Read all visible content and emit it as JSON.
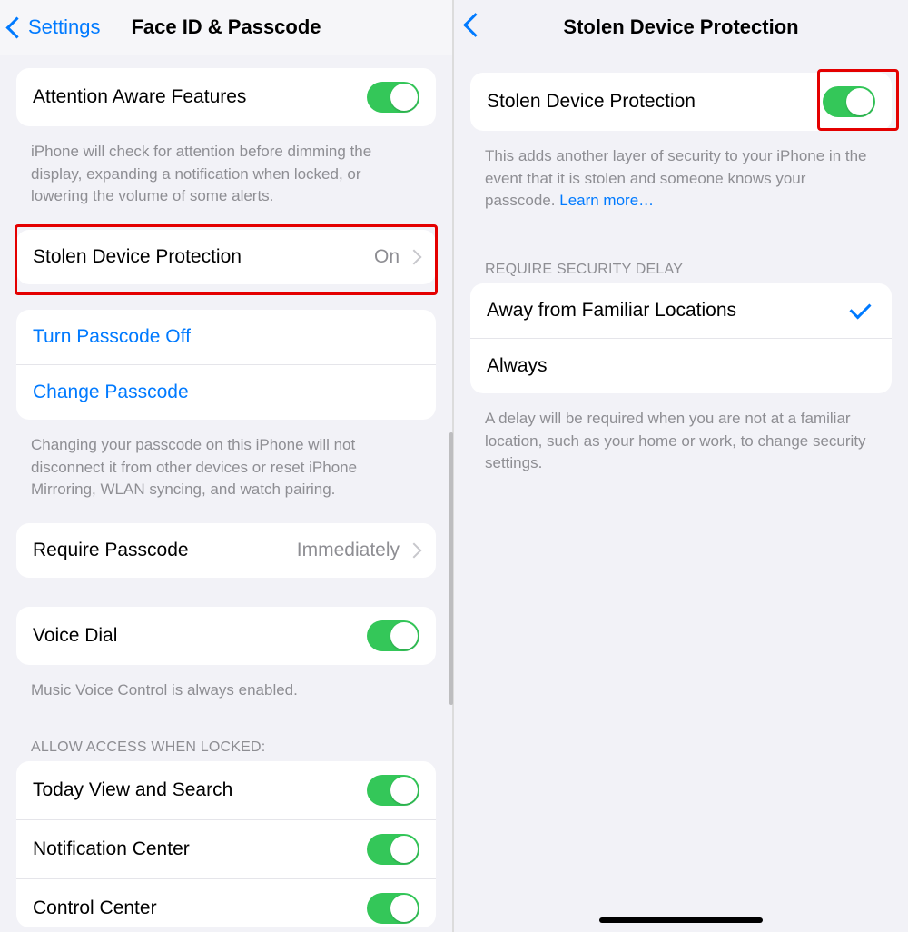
{
  "left": {
    "back": "Settings",
    "title": "Face ID & Passcode",
    "attention_label": "Attention Aware Features",
    "attention_footer": "iPhone will check for attention before dimming the display, expanding a notification when locked, or lowering the volume of some alerts.",
    "sdp_label": "Stolen Device Protection",
    "sdp_value": "On",
    "turn_off": "Turn Passcode Off",
    "change_pass": "Change Passcode",
    "change_footer": "Changing your passcode on this iPhone will not disconnect it from other devices or reset iPhone Mirroring, WLAN syncing, and watch pairing.",
    "require_label": "Require Passcode",
    "require_value": "Immediately",
    "voice_label": "Voice Dial",
    "voice_footer": "Music Voice Control is always enabled.",
    "allow_header": "ALLOW ACCESS WHEN LOCKED:",
    "today": "Today View and Search",
    "notif": "Notification Center",
    "control": "Control Center"
  },
  "right": {
    "title": "Stolen Device Protection",
    "sdp_label": "Stolen Device Protection",
    "sdp_footer_a": "This adds another layer of security to your iPhone in the event that it is stolen and someone knows your passcode. ",
    "sdp_learn": "Learn more…",
    "delay_header": "REQUIRE SECURITY DELAY",
    "opt_away": "Away from Familiar Locations",
    "opt_always": "Always",
    "delay_footer": "A delay will be required when you are not at a familiar location, such as your home or work, to change security settings."
  }
}
